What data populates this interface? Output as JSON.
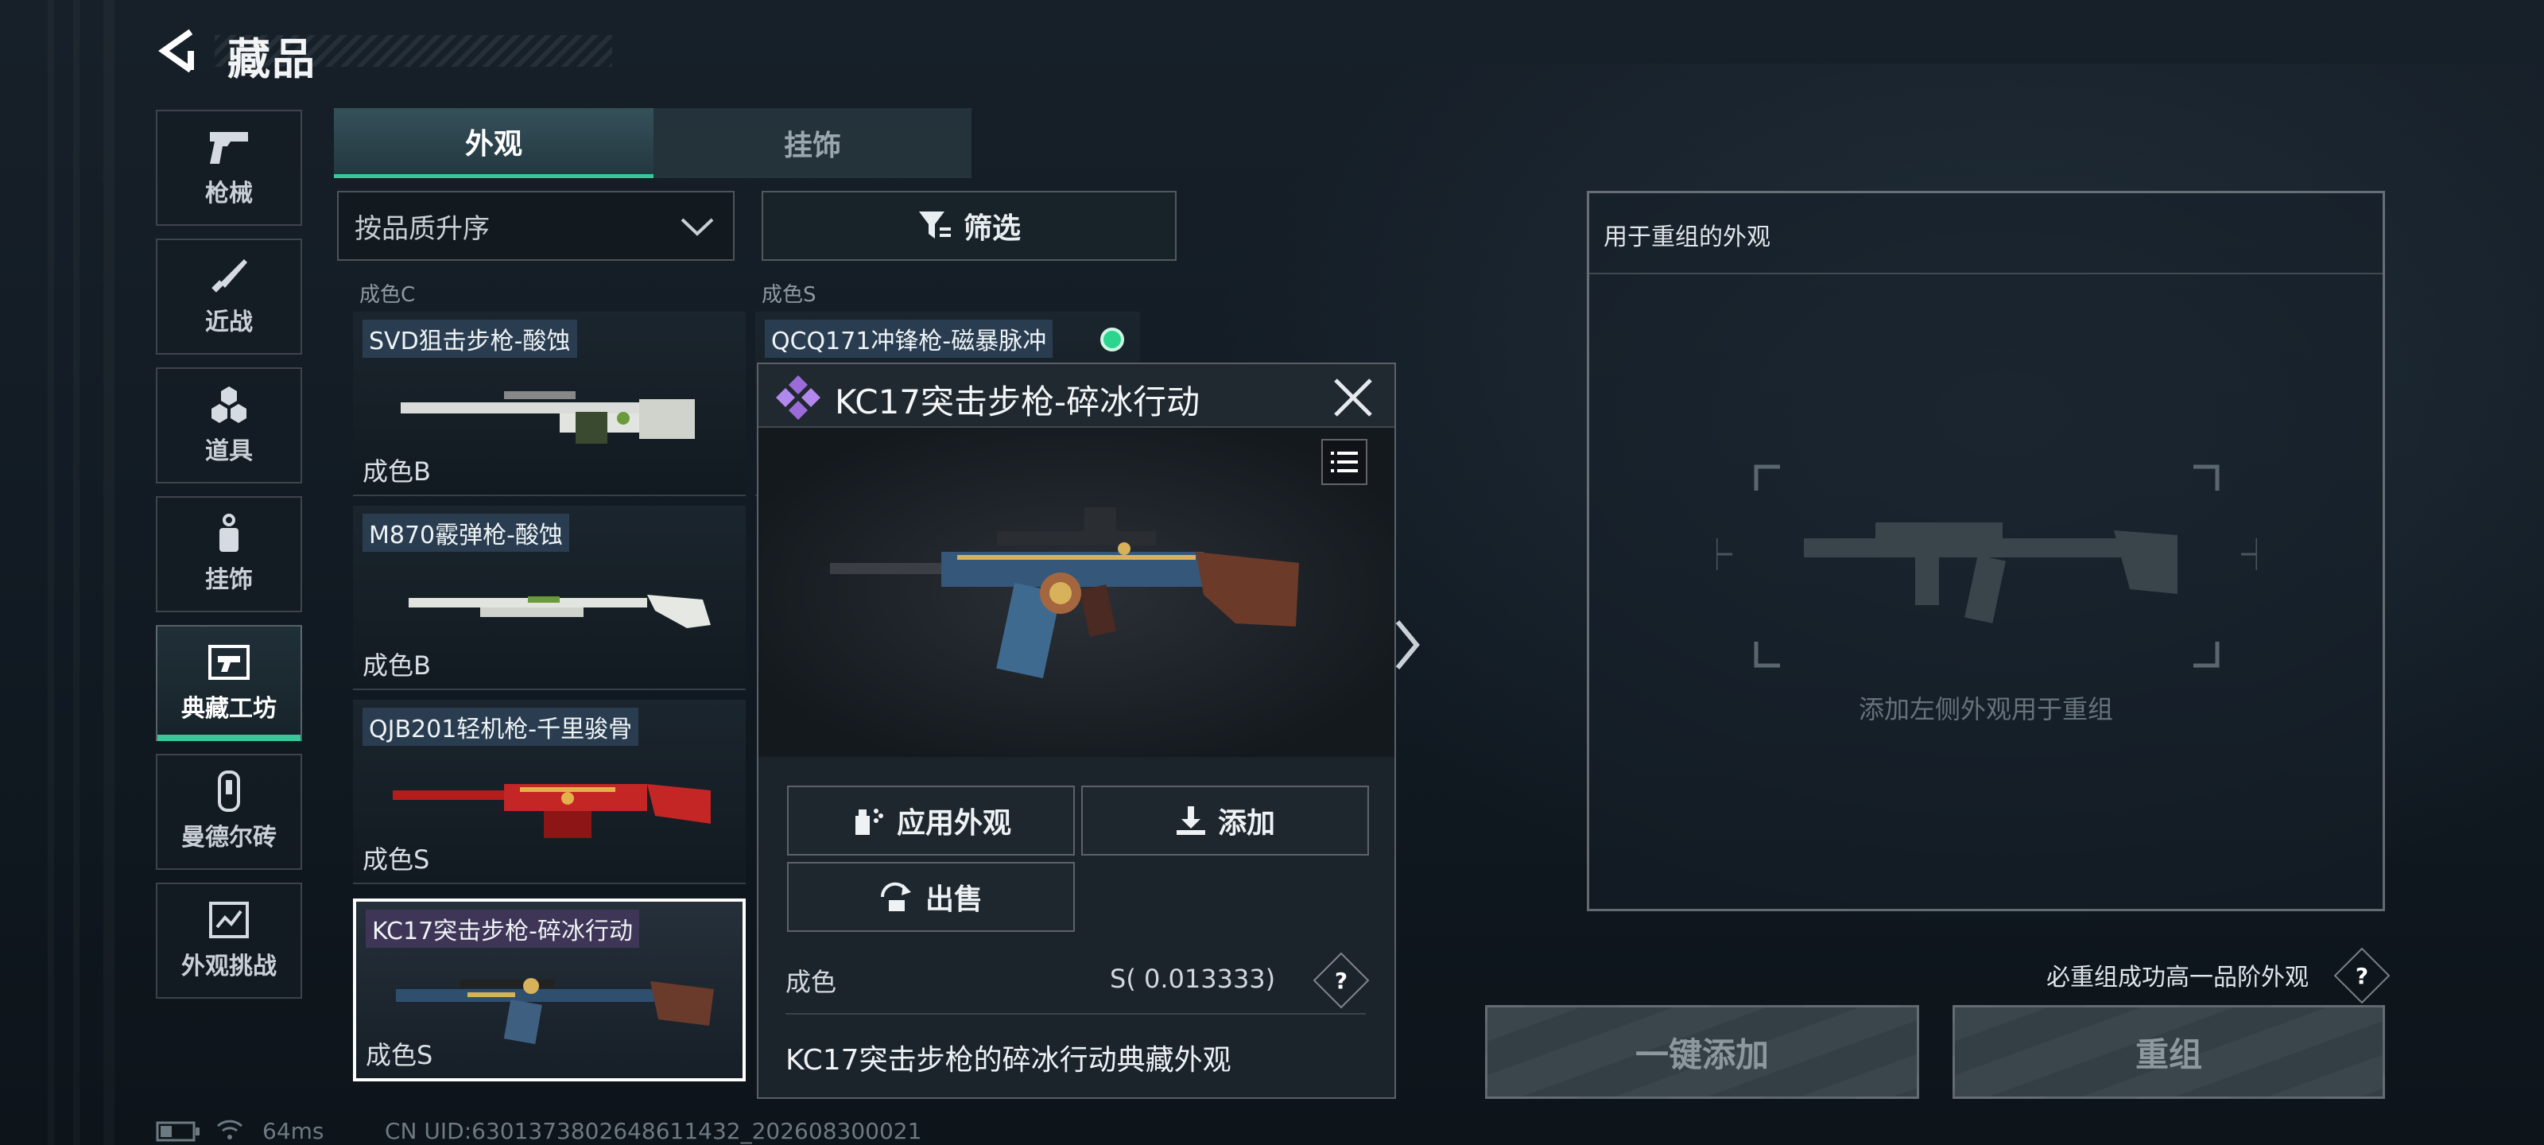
{
  "header": {
    "title": "藏品"
  },
  "sidebar": {
    "items": [
      {
        "label": "枪械",
        "icon": "pistol-icon"
      },
      {
        "label": "近战",
        "icon": "knife-icon"
      },
      {
        "label": "道具",
        "icon": "grenades-icon"
      },
      {
        "label": "挂饰",
        "icon": "charm-icon"
      },
      {
        "label": "典藏工坊",
        "icon": "workshop-icon",
        "active": true
      },
      {
        "label": "曼德尔砖",
        "icon": "brick-icon"
      },
      {
        "label": "外观挑战",
        "icon": "challenge-icon"
      }
    ]
  },
  "tabs": [
    {
      "label": "外观",
      "active": true
    },
    {
      "label": "挂饰",
      "active": false
    }
  ],
  "controls": {
    "sort": "按品质升序",
    "filter": "筛选"
  },
  "grid": {
    "partial_top": [
      "成色C",
      "成色S"
    ],
    "cards": [
      {
        "name": "SVD狙击步枪-酸蚀",
        "grade": "成色B"
      },
      {
        "name": "QCQ171冲锋枪-磁暴脉冲",
        "grade": ""
      },
      {
        "name": "M870霰弹枪-酸蚀",
        "grade": "成色B"
      },
      {
        "name": "QJB201轻机枪-千里骏骨",
        "grade": "成色S"
      },
      {
        "name": "KC17突击步枪-碎冰行动",
        "grade": "成色S"
      }
    ]
  },
  "popup": {
    "title": "KC17突击步枪-碎冰行动",
    "apply": "应用外观",
    "add": "添加",
    "sell": "出售",
    "grade_label": "成色",
    "grade_value": "S( 0.013333)",
    "help": "?",
    "description": "KC17突击步枪的碎冰行动典藏外观"
  },
  "right_panel": {
    "title": "用于重组的外观",
    "hint": "添加左侧外观用于重组",
    "guarantee": "必重组成功高一品阶外观",
    "help": "?",
    "one_click_add": "一键添加",
    "recombine": "重组"
  },
  "status": {
    "ping": "64ms",
    "uid": "CN UID:6301373802648611432_202608300021"
  },
  "colors": {
    "accent": "#39c79a",
    "indicator": "#2bd58f",
    "rarity": "#9b6cd9"
  }
}
